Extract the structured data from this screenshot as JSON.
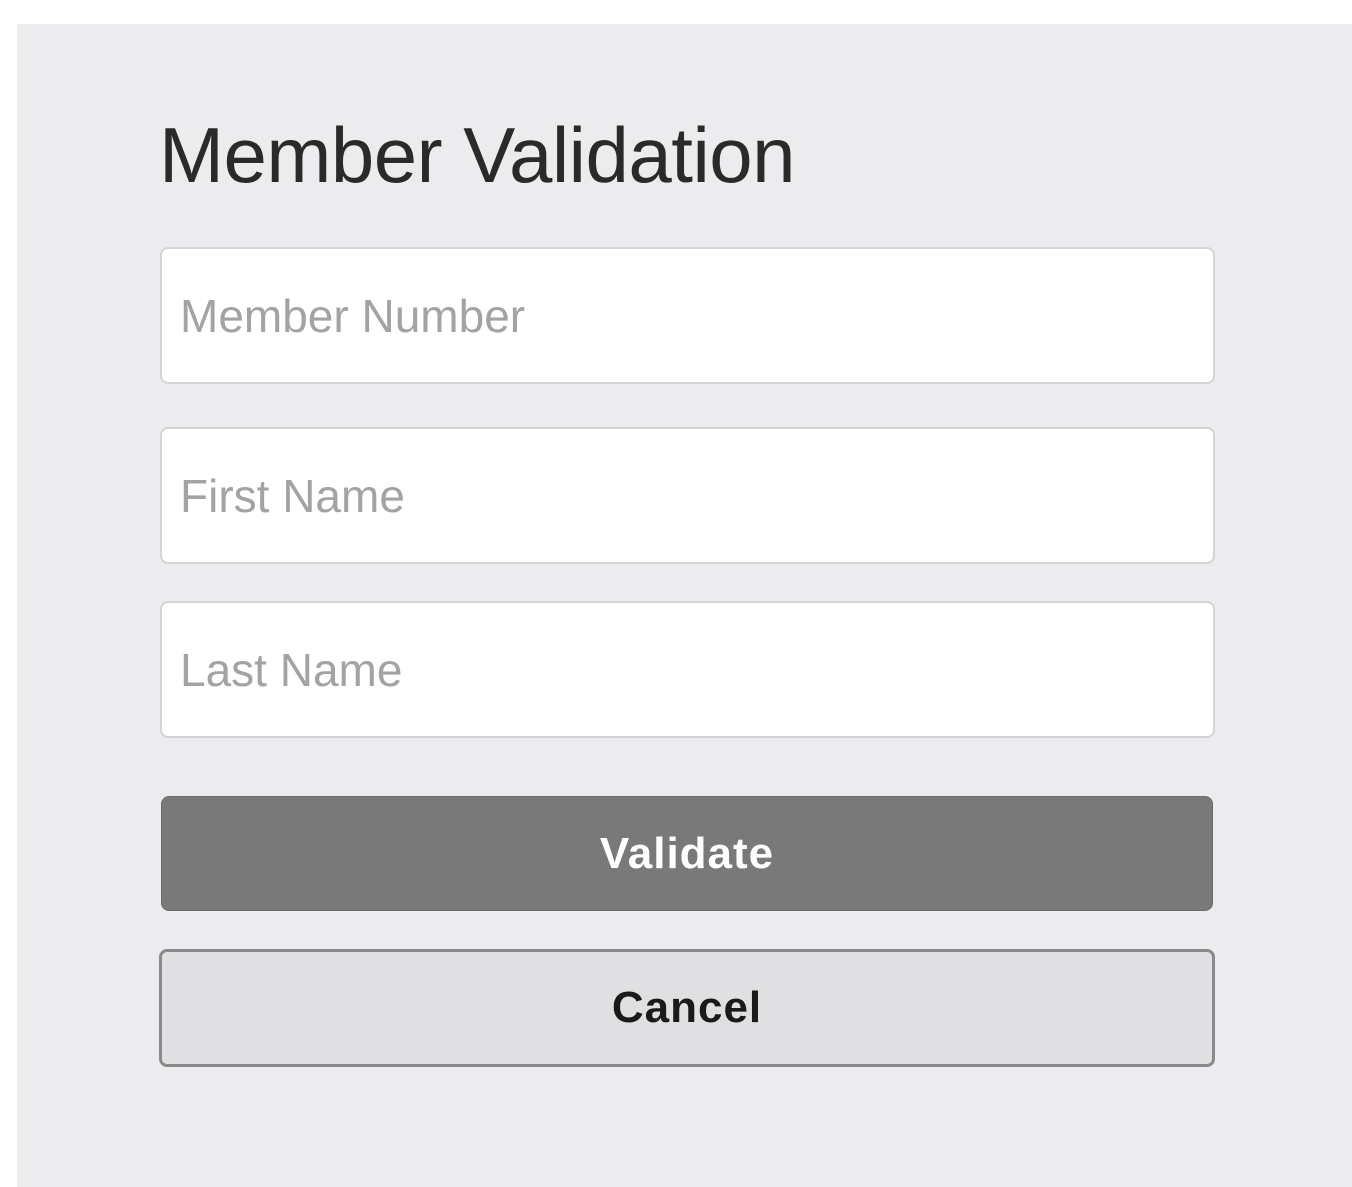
{
  "form": {
    "title": "Member Validation",
    "fields": [
      {
        "name": "member-number",
        "value": "",
        "placeholder": "Member Number"
      },
      {
        "name": "first-name",
        "value": "",
        "placeholder": "First Name"
      },
      {
        "name": "last-name",
        "value": "",
        "placeholder": "Last Name"
      }
    ],
    "validate_label": "Validate",
    "cancel_label": "Cancel"
  },
  "colors": {
    "background": "#ececee",
    "primary_button": "#797979",
    "secondary_button": "#e0e0e2",
    "placeholder_text": "#a3a3a3"
  }
}
